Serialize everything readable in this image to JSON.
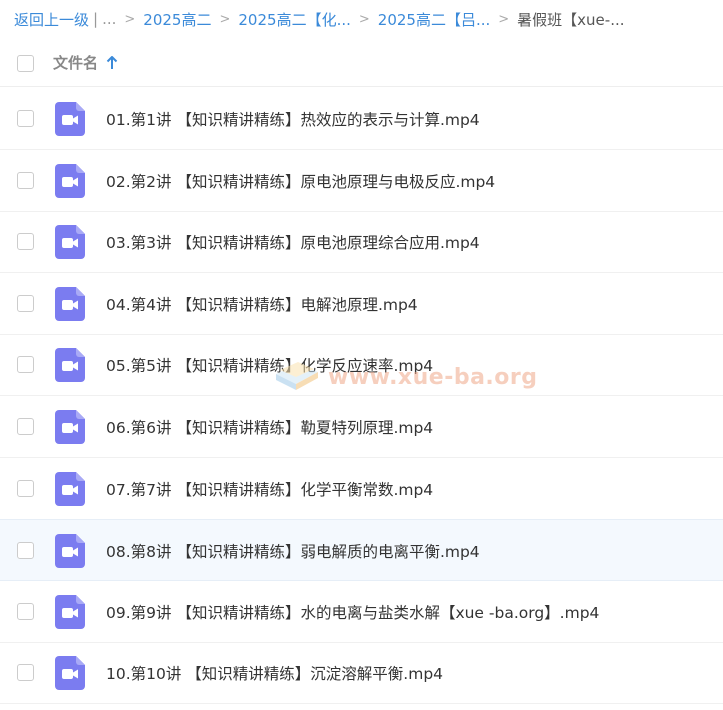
{
  "breadcrumb": {
    "back": "返回上一级",
    "separator_pipe": "|",
    "ellipsis": "...",
    "items": [
      {
        "label": "2025高二"
      },
      {
        "label": "2025高二【化..."
      },
      {
        "label": "2025高二【吕..."
      }
    ],
    "current": "暑假班【xue-..."
  },
  "header": {
    "column_label": "文件名",
    "sort_direction": "ascending"
  },
  "files": [
    {
      "name": "01.第1讲 【知识精讲精练】热效应的表示与计算.mp4",
      "icon": "video-file-icon"
    },
    {
      "name": "02.第2讲 【知识精讲精练】原电池原理与电极反应.mp4",
      "icon": "video-file-icon"
    },
    {
      "name": "03.第3讲 【知识精讲精练】原电池原理综合应用.mp4",
      "icon": "video-file-icon"
    },
    {
      "name": "04.第4讲 【知识精讲精练】电解池原理.mp4",
      "icon": "video-file-icon"
    },
    {
      "name": "05.第5讲 【知识精讲精练】化学反应速率.mp4",
      "icon": "video-file-icon"
    },
    {
      "name": "06.第6讲 【知识精讲精练】勒夏特列原理.mp4",
      "icon": "video-file-icon"
    },
    {
      "name": "07.第7讲 【知识精讲精练】化学平衡常数.mp4",
      "icon": "video-file-icon"
    },
    {
      "name": "08.第8讲 【知识精讲精练】弱电解质的电离平衡.mp4",
      "icon": "video-file-icon"
    },
    {
      "name": "09.第9讲 【知识精讲精练】水的电离与盐类水解【xue -ba.org】.mp4",
      "icon": "video-file-icon"
    },
    {
      "name": "10.第10讲 【知识精讲精练】沉淀溶解平衡.mp4",
      "icon": "video-file-icon"
    }
  ],
  "watermark": {
    "text": "www.xue-ba.org"
  },
  "colors": {
    "link": "#3b8ad9",
    "video_icon": "#7b7cf0",
    "hover_row": "#f4f9fe"
  }
}
